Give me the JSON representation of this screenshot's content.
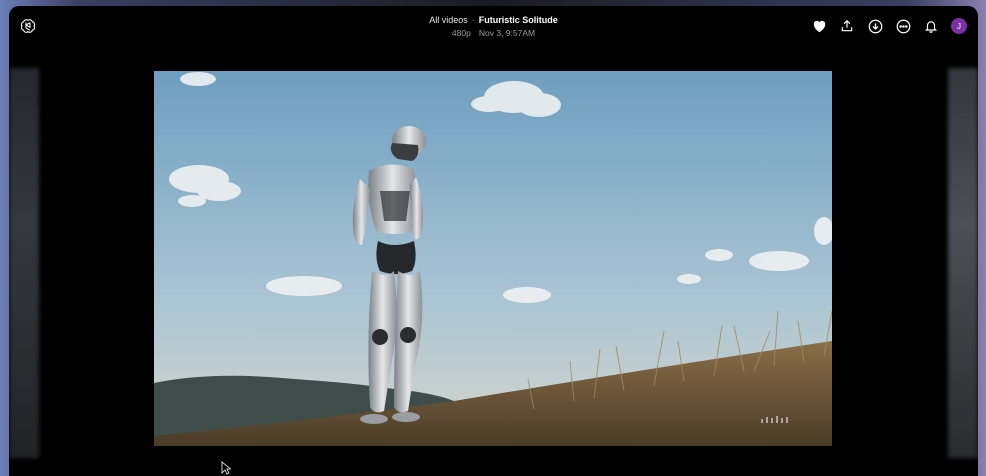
{
  "header": {
    "breadcrumb": "All videos",
    "separator": "·",
    "title": "Futuristic Solitude",
    "resolution": "480p",
    "timestamp": "Nov 3, 9:57AM"
  },
  "actions": [
    {
      "name": "favorite",
      "icon": "heart-icon"
    },
    {
      "name": "share",
      "icon": "upload-icon"
    },
    {
      "name": "download",
      "icon": "download-icon"
    },
    {
      "name": "more",
      "icon": "more-icon"
    },
    {
      "name": "notifications",
      "icon": "bell-icon"
    }
  ],
  "user": {
    "avatar_initial": "J",
    "avatar_color": "#7b2fa8"
  },
  "colors": {
    "window_bg": "#000000",
    "text_primary": "#ffffff",
    "text_muted": "#9a9a9a"
  }
}
